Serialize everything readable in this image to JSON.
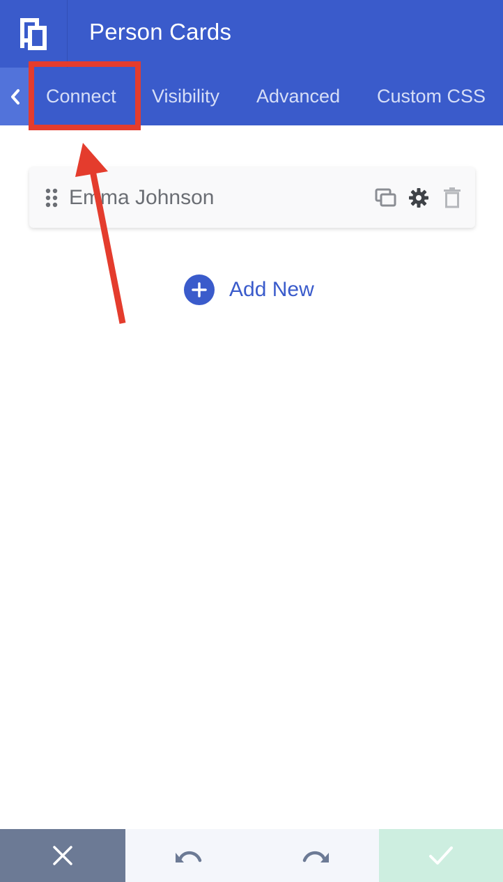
{
  "header": {
    "title": "Person Cards",
    "logo_icon": "brand-logo-icon"
  },
  "tabs": {
    "back_icon": "chevron-left-icon",
    "items": [
      {
        "label": "Connect",
        "active": true
      },
      {
        "label": "Visibility"
      },
      {
        "label": "Advanced"
      },
      {
        "label": "Custom CSS"
      }
    ]
  },
  "list": {
    "items": [
      {
        "label": "Emma Johnson",
        "icons": [
          "drag-handle-icon",
          "duplicate-icon",
          "gear-icon",
          "trash-icon"
        ]
      }
    ],
    "add_label": "Add New"
  },
  "footer": {
    "cancel_icon": "close-icon",
    "undo_icon": "undo-icon",
    "redo_icon": "redo-icon",
    "save_icon": "check-icon"
  },
  "colors": {
    "brand": "#3a5bcb",
    "tab_text": "#d6def7",
    "annotation": "#e43c2d",
    "cancel_bg": "#6c7a95",
    "undo_redo_bg": "#f4f6fb",
    "save_bg": "#cdeee0"
  }
}
